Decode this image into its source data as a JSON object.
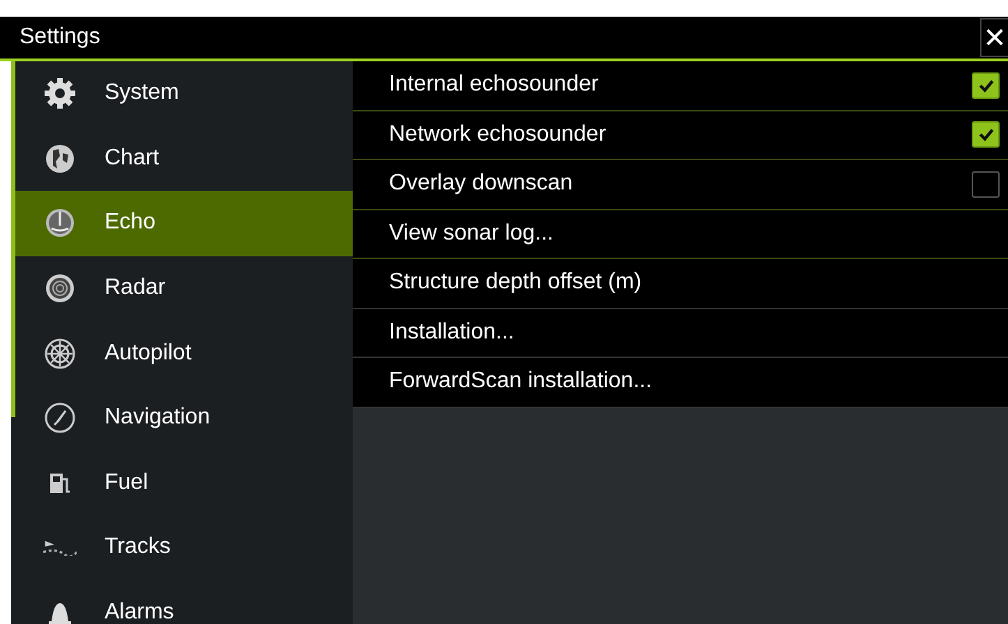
{
  "window": {
    "title": "Settings",
    "close": "✕"
  },
  "sidebar": {
    "items": [
      {
        "label": "System",
        "selected": false
      },
      {
        "label": "Chart",
        "selected": false
      },
      {
        "label": "Echo",
        "selected": true
      },
      {
        "label": "Radar",
        "selected": false
      },
      {
        "label": "Autopilot",
        "selected": false
      },
      {
        "label": "Navigation",
        "selected": false
      },
      {
        "label": "Fuel",
        "selected": false
      },
      {
        "label": "Tracks",
        "selected": false
      },
      {
        "label": "Alarms",
        "selected": false
      }
    ]
  },
  "options": [
    {
      "label": "Internal echosounder",
      "kind": "checkbox",
      "checked": true
    },
    {
      "label": "Network echosounder",
      "kind": "checkbox",
      "checked": true
    },
    {
      "label": "Overlay downscan",
      "kind": "checkbox",
      "checked": false
    },
    {
      "label": "View sonar log...",
      "kind": "action"
    },
    {
      "label": "Structure depth offset (m)",
      "kind": "action"
    },
    {
      "label": "Installation...",
      "kind": "action"
    },
    {
      "label": "ForwardScan installation...",
      "kind": "action"
    }
  ]
}
